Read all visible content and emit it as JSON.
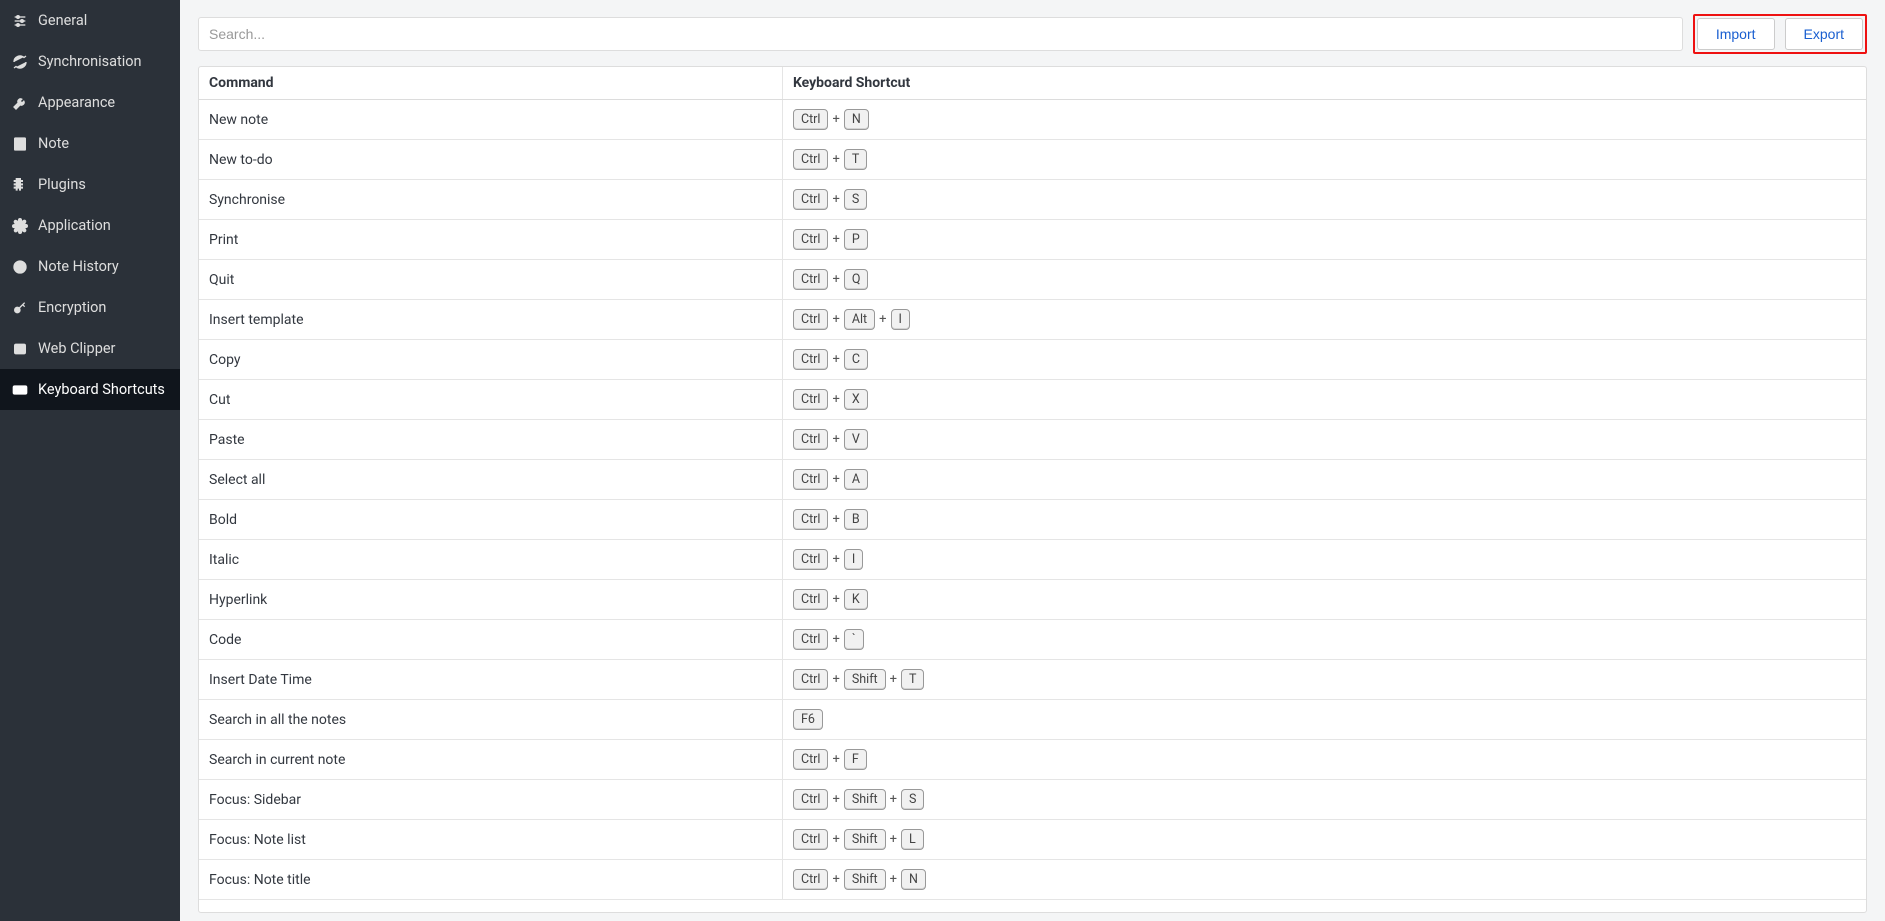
{
  "sidebar": {
    "items": [
      {
        "label": "General",
        "icon": "sliders-icon",
        "active": false
      },
      {
        "label": "Synchronisation",
        "icon": "sync-icon",
        "active": false
      },
      {
        "label": "Appearance",
        "icon": "tools-icon",
        "active": false
      },
      {
        "label": "Note",
        "icon": "note-icon",
        "active": false
      },
      {
        "label": "Plugins",
        "icon": "plugin-icon",
        "active": false
      },
      {
        "label": "Application",
        "icon": "gear-icon",
        "active": false
      },
      {
        "label": "Note History",
        "icon": "history-icon",
        "active": false
      },
      {
        "label": "Encryption",
        "icon": "key-icon",
        "active": false
      },
      {
        "label": "Web Clipper",
        "icon": "clipper-icon",
        "active": false
      },
      {
        "label": "Keyboard Shortcuts",
        "icon": "keyboard-icon",
        "active": true
      }
    ]
  },
  "toolbar": {
    "search_placeholder": "Search...",
    "import_label": "Import",
    "export_label": "Export"
  },
  "table": {
    "headers": {
      "command": "Command",
      "shortcut": "Keyboard Shortcut"
    },
    "rows": [
      {
        "command": "New note",
        "keys": [
          "Ctrl",
          "N"
        ]
      },
      {
        "command": "New to-do",
        "keys": [
          "Ctrl",
          "T"
        ]
      },
      {
        "command": "Synchronise",
        "keys": [
          "Ctrl",
          "S"
        ]
      },
      {
        "command": "Print",
        "keys": [
          "Ctrl",
          "P"
        ]
      },
      {
        "command": "Quit",
        "keys": [
          "Ctrl",
          "Q"
        ]
      },
      {
        "command": "Insert template",
        "keys": [
          "Ctrl",
          "Alt",
          "I"
        ]
      },
      {
        "command": "Copy",
        "keys": [
          "Ctrl",
          "C"
        ]
      },
      {
        "command": "Cut",
        "keys": [
          "Ctrl",
          "X"
        ]
      },
      {
        "command": "Paste",
        "keys": [
          "Ctrl",
          "V"
        ]
      },
      {
        "command": "Select all",
        "keys": [
          "Ctrl",
          "A"
        ]
      },
      {
        "command": "Bold",
        "keys": [
          "Ctrl",
          "B"
        ]
      },
      {
        "command": "Italic",
        "keys": [
          "Ctrl",
          "I"
        ]
      },
      {
        "command": "Hyperlink",
        "keys": [
          "Ctrl",
          "K"
        ]
      },
      {
        "command": "Code",
        "keys": [
          "Ctrl",
          "`"
        ]
      },
      {
        "command": "Insert Date Time",
        "keys": [
          "Ctrl",
          "Shift",
          "T"
        ]
      },
      {
        "command": "Search in all the notes",
        "keys": [
          "F6"
        ]
      },
      {
        "command": "Search in current note",
        "keys": [
          "Ctrl",
          "F"
        ]
      },
      {
        "command": "Focus: Sidebar",
        "keys": [
          "Ctrl",
          "Shift",
          "S"
        ]
      },
      {
        "command": "Focus: Note list",
        "keys": [
          "Ctrl",
          "Shift",
          "L"
        ]
      },
      {
        "command": "Focus: Note title",
        "keys": [
          "Ctrl",
          "Shift",
          "N"
        ]
      }
    ]
  }
}
